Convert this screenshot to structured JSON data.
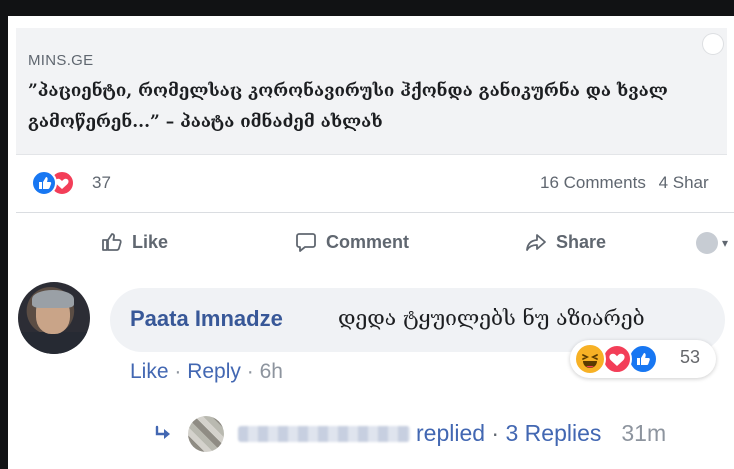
{
  "link_preview": {
    "domain": "MINS.GE",
    "headline": "”პაციენტი, რომელსაც კორონავირუსი ჰქონდა განიკურნა და ხვალ გამოწერენ...” – პაატა იმნაძემ ახლახ"
  },
  "stats": {
    "reactions": [
      "like",
      "love"
    ],
    "reaction_count": "37",
    "comments": "16 Comments",
    "shares": "4 Shar"
  },
  "actions": {
    "like": "Like",
    "comment": "Comment",
    "share": "Share"
  },
  "comment": {
    "author": "Paata Imnadze",
    "text": "დედა ტყუილებს ნუ აზიარებ",
    "reactions": [
      "haha",
      "love",
      "like"
    ],
    "reaction_count": "53",
    "meta": {
      "like": "Like",
      "sep1": " · ",
      "reply": "Reply",
      "sep2": " · ",
      "time": "6h"
    }
  },
  "replies": {
    "replied": "replied",
    "sep": " · ",
    "count": "3 Replies",
    "time": "31m"
  },
  "colors": {
    "link_blue": "#385898",
    "like_blue": "#1877f2",
    "love_red": "#f33e58",
    "haha_yellow": "#f7b125"
  }
}
